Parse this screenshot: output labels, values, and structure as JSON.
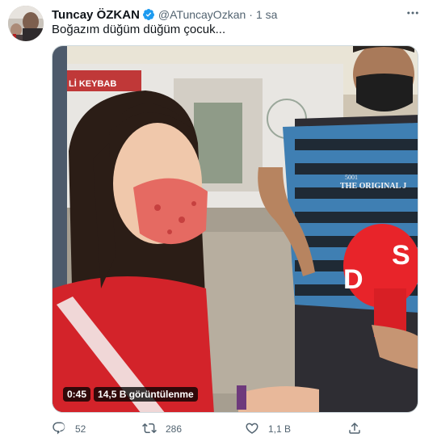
{
  "tweet": {
    "author_name": "Tuncay ÖZKAN",
    "handle": "@ATuncayOzkan",
    "separator": "·",
    "time": "1 sa",
    "text": "Boğazım düğüm düğüm çocuk..."
  },
  "video": {
    "duration": "0:45",
    "views": "14,5 B görüntülenme",
    "caption_tshirt": "THE ORIGINAL J",
    "caption_tshirt_num": "5001",
    "caption_banner": "Lİ KEYBAB"
  },
  "actions": {
    "replies": "52",
    "retweets": "286",
    "likes": "1,1 B"
  },
  "icons": {
    "verified": "verified-badge-icon",
    "more": "more-icon",
    "reply": "reply-icon",
    "retweet": "retweet-icon",
    "like": "like-icon",
    "share": "share-icon"
  },
  "colors": {
    "text_primary": "#0f1419",
    "text_secondary": "#536471",
    "verified_blue": "#1d9bf0"
  }
}
